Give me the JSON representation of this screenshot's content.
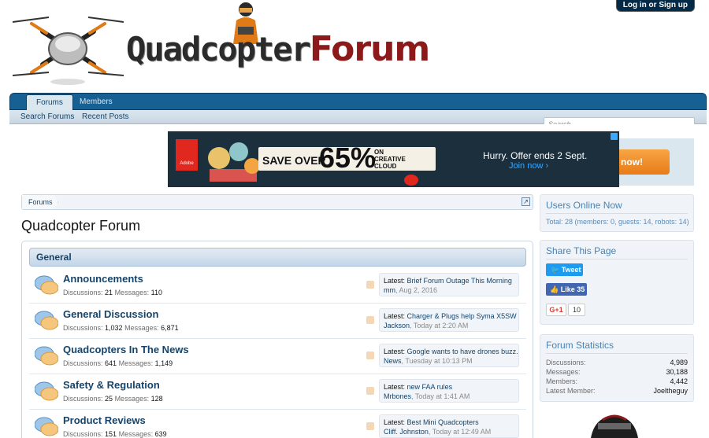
{
  "header": {
    "login_label": "Log in or Sign up",
    "logo_part1": "Quadcopter",
    "logo_part2": "Forum"
  },
  "nav": {
    "tabs": [
      {
        "label": "Forums",
        "active": true
      },
      {
        "label": "Members",
        "active": false
      }
    ],
    "sub_links": [
      "Search Forums",
      "Recent Posts"
    ],
    "search_placeholder": "Search..."
  },
  "ad": {
    "brand": "Adobe",
    "save_text": "SAVE OVER",
    "percent": "65%",
    "on_text": "ON",
    "product_line1": "CREATIVE",
    "product_line2": "CLOUD",
    "hurry_text": "Hurry. Offer ends 2 Sept.",
    "join_text": "Join now ›",
    "side_cta": "now!"
  },
  "breadcrumb": {
    "items": [
      "Forums"
    ]
  },
  "page_title": "Quadcopter Forum",
  "category": {
    "title": "General"
  },
  "forums": [
    {
      "title": "Announcements",
      "discussions": "21",
      "messages": "110",
      "latest_title": "Brief Forum Outage This Morning",
      "latest_user": "mm",
      "latest_date": "Aug 2, 2016"
    },
    {
      "title": "General Discussion",
      "discussions": "1,032",
      "messages": "6,871",
      "latest_title": "Charger & Plugs help Syma X5SW ...",
      "latest_user": "Jackson",
      "latest_date": "Today at 2:20 AM"
    },
    {
      "title": "Quadcopters In The News",
      "discussions": "641",
      "messages": "1,149",
      "latest_title": "Google wants to have drones buzz...",
      "latest_user": "News",
      "latest_date": "Tuesday at 10:13 PM"
    },
    {
      "title": "Safety & Regulation",
      "discussions": "25",
      "messages": "128",
      "latest_title": "new FAA rules",
      "latest_user": "Mrbones",
      "latest_date": "Today at 1:41 AM"
    },
    {
      "title": "Product Reviews",
      "discussions": "151",
      "messages": "639",
      "latest_title": "Best Mini Quadcopters",
      "latest_user": "Cliff. Johnston",
      "latest_date": "Today at 12:49 AM"
    }
  ],
  "labels": {
    "discussions": "Discussions:",
    "messages": "Messages:",
    "latest": "Latest:",
    "separator": ", "
  },
  "sidebar": {
    "online_title": "Users Online Now",
    "online_total": "Total: 28 (members: 0, guests: 14, robots: 14)",
    "share_title": "Share This Page",
    "tweet_label": "Tweet",
    "like_label": "Like 35",
    "gplus_label": "G+1",
    "gplus_count": "10",
    "stats_title": "Forum Statistics",
    "stats": [
      {
        "label": "Discussions:",
        "value": "4,989"
      },
      {
        "label": "Messages:",
        "value": "30,188"
      },
      {
        "label": "Members:",
        "value": "4,442"
      },
      {
        "label": "Latest Member:",
        "value": "Joeltheguy"
      }
    ]
  },
  "colors": {
    "nav_blue": "#176093",
    "link_blue": "#14446b",
    "logo_red": "#8c1a1a",
    "sidebar_title": "#4b82b2"
  }
}
